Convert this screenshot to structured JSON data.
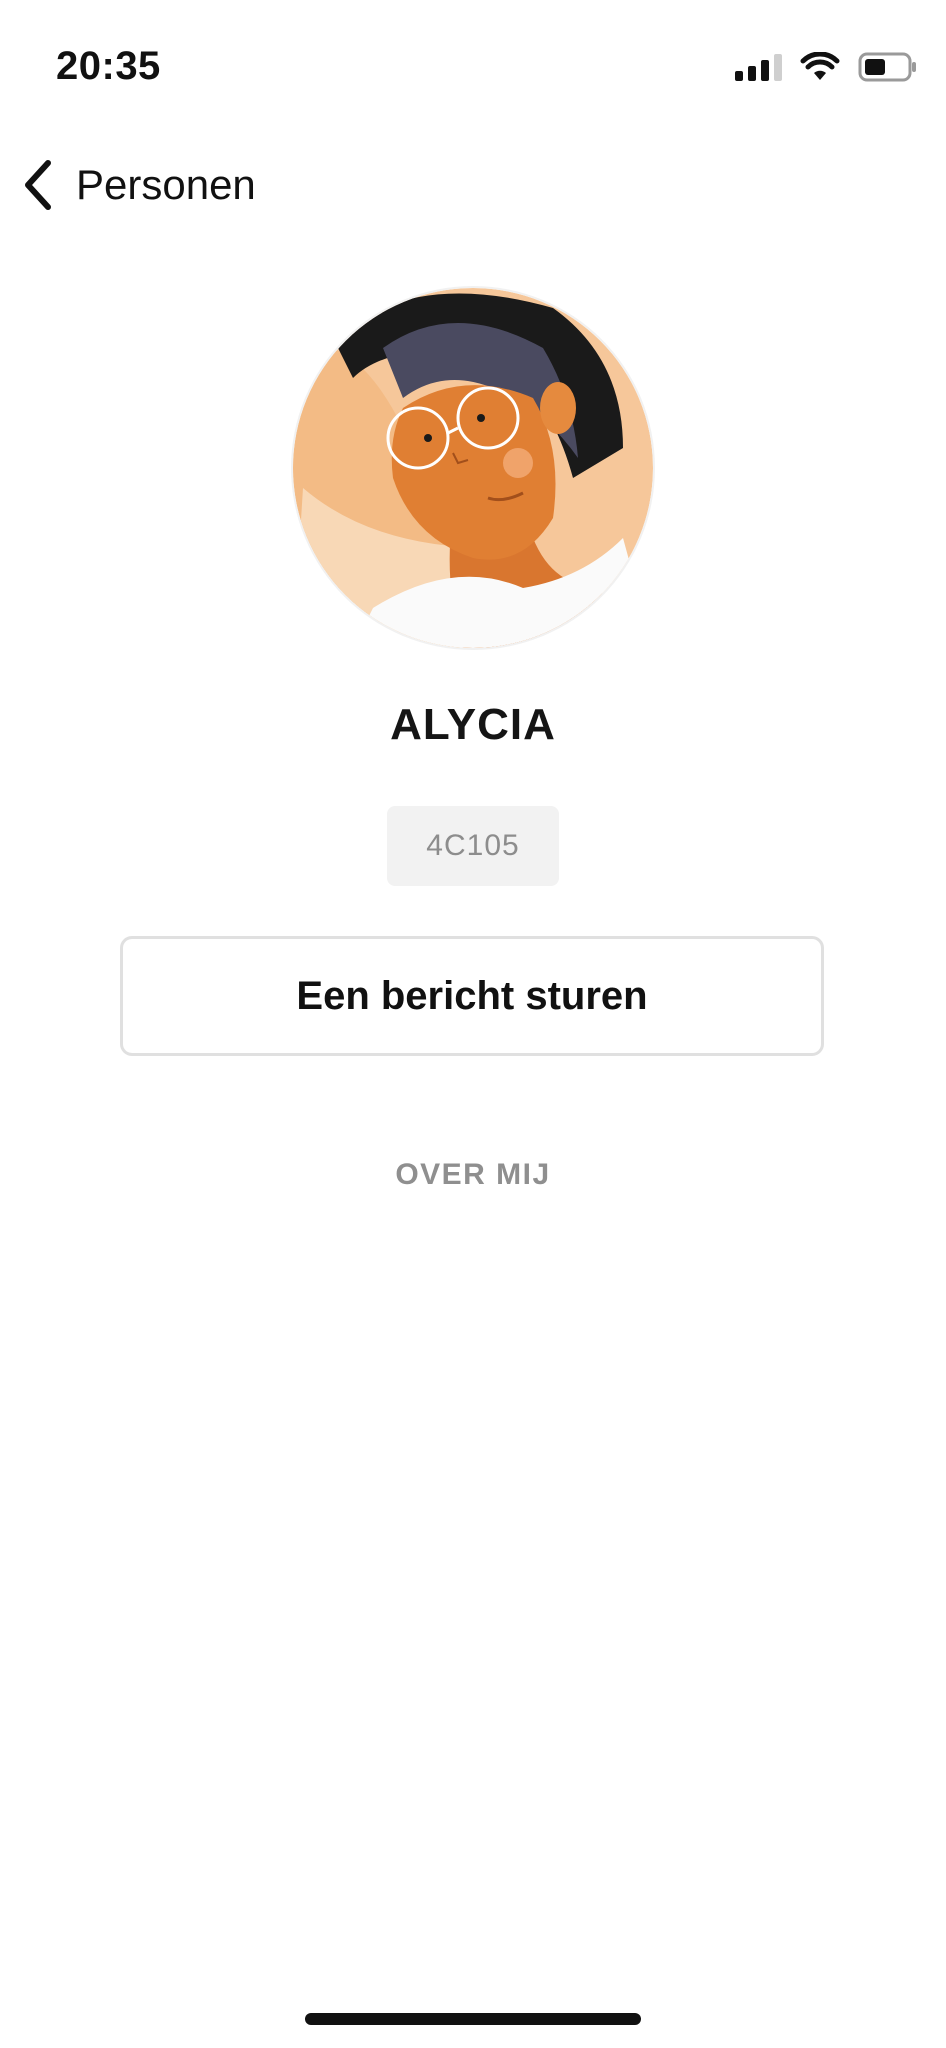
{
  "status_bar": {
    "time": "20:35",
    "icons": [
      "signal-icon",
      "wifi-icon",
      "battery-icon"
    ]
  },
  "nav": {
    "back_label": "Personen",
    "back_icon": "chevron-left-icon"
  },
  "profile": {
    "avatar_icon": "person-avatar-illustration",
    "name": "ALYCIA",
    "room": "4C105",
    "message_button_label": "Een bericht sturen",
    "section_heading": "OVER MIJ"
  },
  "colors": {
    "background": "#ffffff",
    "text": "#111111",
    "muted": "#8f8f8f",
    "badge_bg": "#f2f2f2",
    "button_border": "#e0e0e0"
  }
}
